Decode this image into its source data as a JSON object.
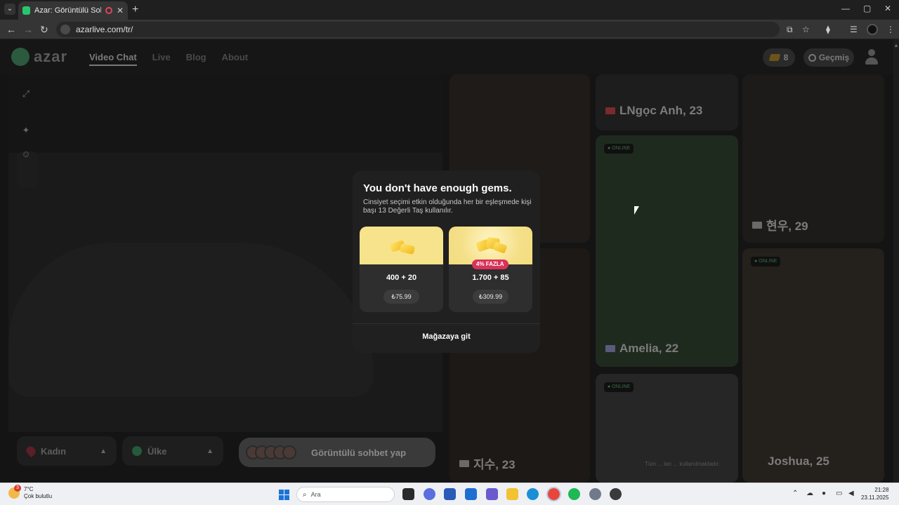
{
  "browser": {
    "tab_title": "Azar: Görüntülü Sohbet, Yabancılarla Görüntülü Sohbet",
    "url": "azarlive.com/tr/"
  },
  "header": {
    "logo_text": "azar",
    "nav": [
      "Video Chat",
      "Live",
      "Blog",
      "About"
    ],
    "gem_count": "8",
    "history_label": "Geçmiş"
  },
  "controls": {
    "gender_label": "Kadın",
    "country_label": "Ülke",
    "start_label": "Görüntülü sohbet yap"
  },
  "profiles": [
    {
      "name": "LNgọc Anh, 23",
      "online": false
    },
    {
      "name": "현우, 29",
      "online": false
    },
    {
      "name": "Amelia, 22",
      "online": true,
      "badge": "● ONLINE"
    },
    {
      "name": "Joshua, 25",
      "online": true,
      "badge": "● ONLINE"
    },
    {
      "name": "지수, 23",
      "online": false
    },
    {
      "name": "",
      "online": true,
      "badge": "● ONLINE"
    }
  ],
  "footer_note": "Tüm ... ları ... kullanılmaktadır.",
  "modal": {
    "title": "You don't have enough gems.",
    "description": "Cinsiyet seçimi etkin olduğunda her bir eşleşmede kişi başı 13 Değerli Taş kullanılır.",
    "packs": [
      {
        "amount": "400 + 20",
        "price": "₺75.99",
        "bonus": ""
      },
      {
        "amount": "1.700 + 85",
        "price": "₺309.99",
        "bonus": "4% FAZLA"
      }
    ],
    "store_link": "Mağazaya git"
  },
  "taskbar": {
    "weather_temp": "7°C",
    "weather_desc": "Çok bulutlu",
    "weather_badge": "3",
    "search_placeholder": "Ara",
    "time": "21:28",
    "date": "23.11.2025"
  },
  "colors": {
    "modal_bg": "#202020",
    "gold": "#f6e38c",
    "bonus_red": "#d9325a",
    "accent_green": "#29c66d"
  }
}
